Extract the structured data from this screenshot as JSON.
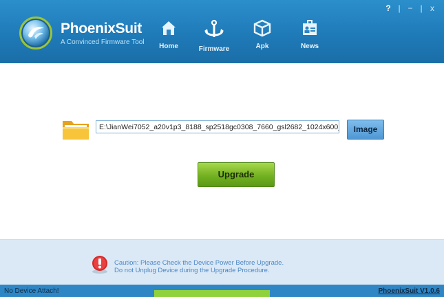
{
  "header": {
    "brand": "PhoenixSuit",
    "tagline": "A Convinced Firmware Tool",
    "window_controls": [
      "?",
      "−",
      "x"
    ]
  },
  "nav": [
    {
      "label": "Home",
      "icon": "home-icon"
    },
    {
      "label": "Firmware",
      "icon": "anchor-icon"
    },
    {
      "label": "Apk",
      "icon": "cube-icon"
    },
    {
      "label": "News",
      "icon": "contact-card-icon"
    }
  ],
  "firmware": {
    "path": "E:\\JianWei7052_a20v1p3_8188_sp2518gc0308_7660_gsl2682_1024x600_",
    "image_button": "Image",
    "upgrade_button": "Upgrade"
  },
  "caution": {
    "line1": "Caution: Please Check the Device Power Before Upgrade.",
    "line2": "Do not Unplug Device during the Upgrade Procedure."
  },
  "status": {
    "left": "No Device Attach!",
    "right": "PhoenixSuit V1.0.6"
  },
  "colors": {
    "header": "#1f7ab8",
    "upgrade": "#6fae1f",
    "caution_bg": "#dbe9f6",
    "caution_text": "#4c86c4"
  }
}
